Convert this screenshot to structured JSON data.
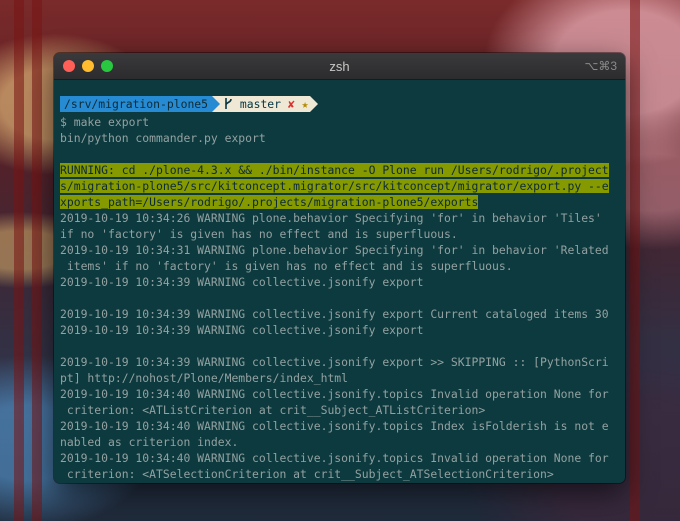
{
  "window": {
    "title": "zsh",
    "shortcut": "⌥⌘3"
  },
  "colors": {
    "background": "#0d3a3e",
    "text": "#93a1a1",
    "path_segment": "#268bd2",
    "git_segment": "#eee8d5",
    "highlight": "#859900",
    "dirty_mark": "#dc322f"
  },
  "prompt": {
    "path": "/srv/migration-plone5",
    "branch_icon": "git-branch-icon",
    "branch": "master",
    "dirty": "✘",
    "star": "★"
  },
  "lines": {
    "cmd": "$ make export",
    "cmd2": "bin/python commander.py export",
    "run1": "RUNNING: cd ./plone-4.3.x && ./bin/instance -O Plone run /Users/rodrigo/.project",
    "run2": "s/migration-plone5/src/kitconcept.migrator/src/kitconcept/migrator/export.py --e",
    "run3": "xports_path=/Users/rodrigo/.projects/migration-plone5/exports",
    "l1": "2019-10-19 10:34:26 WARNING plone.behavior Specifying 'for' in behavior 'Tiles'",
    "l2": "if no 'factory' is given has no effect and is superfluous.",
    "l3": "2019-10-19 10:34:31 WARNING plone.behavior Specifying 'for' in behavior 'Related",
    "l4": " items' if no 'factory' is given has no effect and is superfluous.",
    "l5": "2019-10-19 10:34:39 WARNING collective.jsonify export",
    "l6": "2019-10-19 10:34:39 WARNING collective.jsonify export Current cataloged items 30",
    "l7": "2019-10-19 10:34:39 WARNING collective.jsonify export",
    "l8": "2019-10-19 10:34:39 WARNING collective.jsonify export >> SKIPPING :: [PythonScri",
    "l9": "pt] http://nohost/Plone/Members/index_html",
    "l10": "2019-10-19 10:34:40 WARNING collective.jsonify.topics Invalid operation None for",
    "l11": " criterion: <ATListCriterion at crit__Subject_ATListCriterion>",
    "l12": "2019-10-19 10:34:40 WARNING collective.jsonify.topics Index isFolderish is not e",
    "l13": "nabled as criterion index.",
    "l14": "2019-10-19 10:34:40 WARNING collective.jsonify.topics Invalid operation None for",
    "l15": " criterion: <ATSelectionCriterion at crit__Subject_ATSelectionCriterion>"
  }
}
